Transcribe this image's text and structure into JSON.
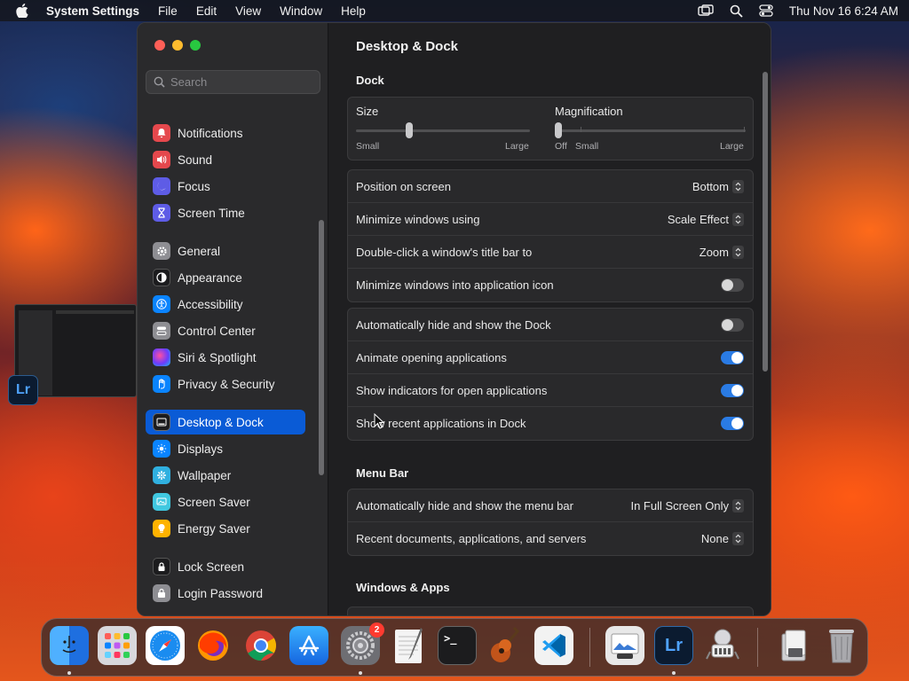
{
  "menubar": {
    "app_name": "System Settings",
    "items": [
      "File",
      "Edit",
      "View",
      "Window",
      "Help"
    ],
    "clock": "Thu Nov 16  6:24 AM"
  },
  "sidebar": {
    "search_placeholder": "Search",
    "items": [
      {
        "label": "Notifications",
        "icon": "bell-icon",
        "color": "#e5484d"
      },
      {
        "label": "Sound",
        "icon": "speaker-icon",
        "color": "#e5484d"
      },
      {
        "label": "Focus",
        "icon": "moon-icon",
        "color": "#5e5ce6"
      },
      {
        "label": "Screen Time",
        "icon": "hourglass-icon",
        "color": "#5e5ce6"
      },
      {
        "label": "General",
        "icon": "gear-icon",
        "color": "#8e8e93"
      },
      {
        "label": "Appearance",
        "icon": "appearance-icon",
        "color": "#1c1c1e"
      },
      {
        "label": "Accessibility",
        "icon": "accessibility-icon",
        "color": "#0a84ff"
      },
      {
        "label": "Control Center",
        "icon": "control-center-icon",
        "color": "#8e8e93"
      },
      {
        "label": "Siri & Spotlight",
        "icon": "siri-icon",
        "color": "#b04de0"
      },
      {
        "label": "Privacy & Security",
        "icon": "hand-icon",
        "color": "#0a84ff"
      },
      {
        "label": "Desktop & Dock",
        "icon": "dock-icon",
        "color": "#1c1c1e"
      },
      {
        "label": "Displays",
        "icon": "sun-icon",
        "color": "#0a84ff"
      },
      {
        "label": "Wallpaper",
        "icon": "flower-icon",
        "color": "#30b0e0"
      },
      {
        "label": "Screen Saver",
        "icon": "screensaver-icon",
        "color": "#40c8e0"
      },
      {
        "label": "Energy Saver",
        "icon": "bulb-icon",
        "color": "#ffb300"
      },
      {
        "label": "Lock Screen",
        "icon": "lock-icon",
        "color": "#1c1c1e"
      },
      {
        "label": "Login Password",
        "icon": "key-icon",
        "color": "#8e8e93"
      }
    ],
    "selected": "Desktop & Dock"
  },
  "content": {
    "title": "Desktop & Dock",
    "dock_section": "Dock",
    "size_label": "Size",
    "size_min": "Small",
    "size_max": "Large",
    "size_value": 0.3,
    "mag_label": "Magnification",
    "mag_off": "Off",
    "mag_min": "Small",
    "mag_max": "Large",
    "mag_value": 0,
    "group1": [
      {
        "label": "Position on screen",
        "value": "Bottom"
      },
      {
        "label": "Minimize windows using",
        "value": "Scale Effect"
      },
      {
        "label": "Double-click a window's title bar to",
        "value": "Zoom"
      },
      {
        "label": "Minimize windows into application icon",
        "toggle": false
      }
    ],
    "group2": [
      {
        "label": "Automatically hide and show the Dock",
        "toggle": false
      },
      {
        "label": "Animate opening applications",
        "toggle": true
      },
      {
        "label": "Show indicators for open applications",
        "toggle": true
      },
      {
        "label": "Show recent applications in Dock",
        "toggle": true
      }
    ],
    "menubar_section": "Menu Bar",
    "group3": [
      {
        "label": "Automatically hide and show the menu bar",
        "value": "In Full Screen Only"
      },
      {
        "label": "Recent documents, applications, and servers",
        "value": "None"
      }
    ],
    "windows_section": "Windows & Apps"
  },
  "floating": {
    "lr_label": "Lr"
  },
  "dock": {
    "apps": [
      {
        "name": "finder-icon",
        "color": "#1e8bf0"
      },
      {
        "name": "launchpad-icon",
        "color": "#dcdcdc"
      },
      {
        "name": "safari-icon",
        "color": "#1a8cf0"
      },
      {
        "name": "firefox-icon",
        "color": "#ff6a00"
      },
      {
        "name": "chrome-icon",
        "color": "#f2f2f2"
      },
      {
        "name": "app-store-icon",
        "color": "#1c8ff5"
      },
      {
        "name": "system-settings-icon",
        "color": "#6e6e73"
      },
      {
        "name": "textedit-icon",
        "color": "#f4f4f4"
      },
      {
        "name": "terminal-icon",
        "color": "#1c1c1e"
      },
      {
        "name": "garageband-icon",
        "color": "#2b2b2d"
      },
      {
        "name": "vscode-icon",
        "color": "#f2f2f2"
      },
      {
        "name": "preview-icon",
        "color": "#e8e8e8"
      },
      {
        "name": "lightroom-icon",
        "color": "#0b1b30"
      },
      {
        "name": "automator-icon",
        "color": "#e8e8e8"
      },
      {
        "name": "downloads-icon",
        "color": "#cfcfcf"
      },
      {
        "name": "trash-icon",
        "color": "#9a9a9e"
      }
    ],
    "settings_badge": "2",
    "terminal_prompt": ">_",
    "lr_text": "Lr"
  }
}
